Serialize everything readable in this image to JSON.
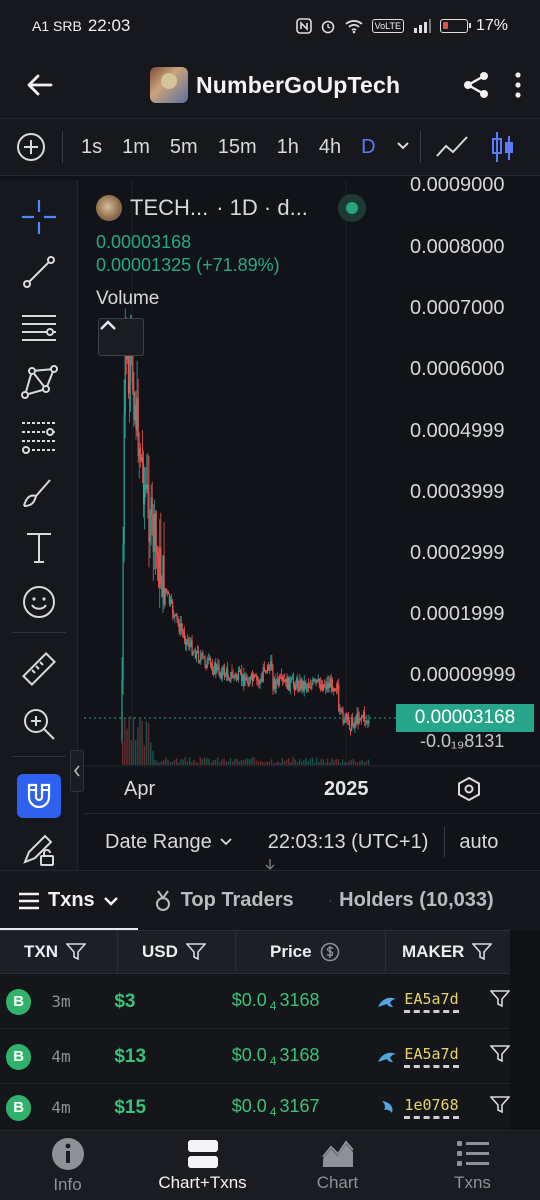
{
  "status": {
    "carrier": "A1 SRB",
    "time": "22:03",
    "volte": "VoLTE",
    "battery": "17%"
  },
  "header": {
    "title": "NumberGoUpTech"
  },
  "timeframes": {
    "items": [
      "1s",
      "1m",
      "5m",
      "15m",
      "1h",
      "4h",
      "D"
    ],
    "active": "D"
  },
  "legend": {
    "symbol": "TECH...",
    "interval": "· 1D · d...",
    "price": "0.00003168",
    "change": "0.00001325 (+71.89%)",
    "volume_label": "Volume"
  },
  "price_axis": {
    "ticks": [
      "0.0009000",
      "0.0008000",
      "0.0007000",
      "0.0006000",
      "0.0004999",
      "0.0003999",
      "0.0002999",
      "0.0001999",
      "0.00009999"
    ],
    "current_price": "0.00003168",
    "below_current": "-0.0₁₉8131"
  },
  "time_axis": {
    "label_1": "Apr",
    "label_2": "2025"
  },
  "range_bar": {
    "date_range": "Date Range",
    "time": "22:03:13 (UTC+1)",
    "scale": "auto"
  },
  "tabs": {
    "txns": "Txns",
    "top_traders": "Top Traders",
    "holders": "Holders (10,033)"
  },
  "table": {
    "headers": {
      "txn": "TXN",
      "usd": "USD",
      "price": "Price",
      "maker": "MAKER"
    },
    "rows": [
      {
        "type": "B",
        "age": "3m",
        "usd": "$3",
        "price_prefix": "$0.0",
        "price_zeros": "4",
        "price_digits": "3168",
        "maker": "EA5a7d"
      },
      {
        "type": "B",
        "age": "4m",
        "usd": "$13",
        "price_prefix": "$0.0",
        "price_zeros": "4",
        "price_digits": "3168",
        "maker": "EA5a7d"
      },
      {
        "type": "B",
        "age": "4m",
        "usd": "$15",
        "price_prefix": "$0.0",
        "price_zeros": "4",
        "price_digits": "3167",
        "maker": "1e0768"
      }
    ]
  },
  "bottom_nav": {
    "info": "Info",
    "chart_txns": "Chart+Txns",
    "chart": "Chart",
    "txns": "Txns"
  },
  "colors": {
    "accent_blue": "#5b7cf6",
    "buy_green": "#2fb36b",
    "price_tag": "#27a58a",
    "candle_up": "#26a69a",
    "candle_down": "#ef5350"
  }
}
